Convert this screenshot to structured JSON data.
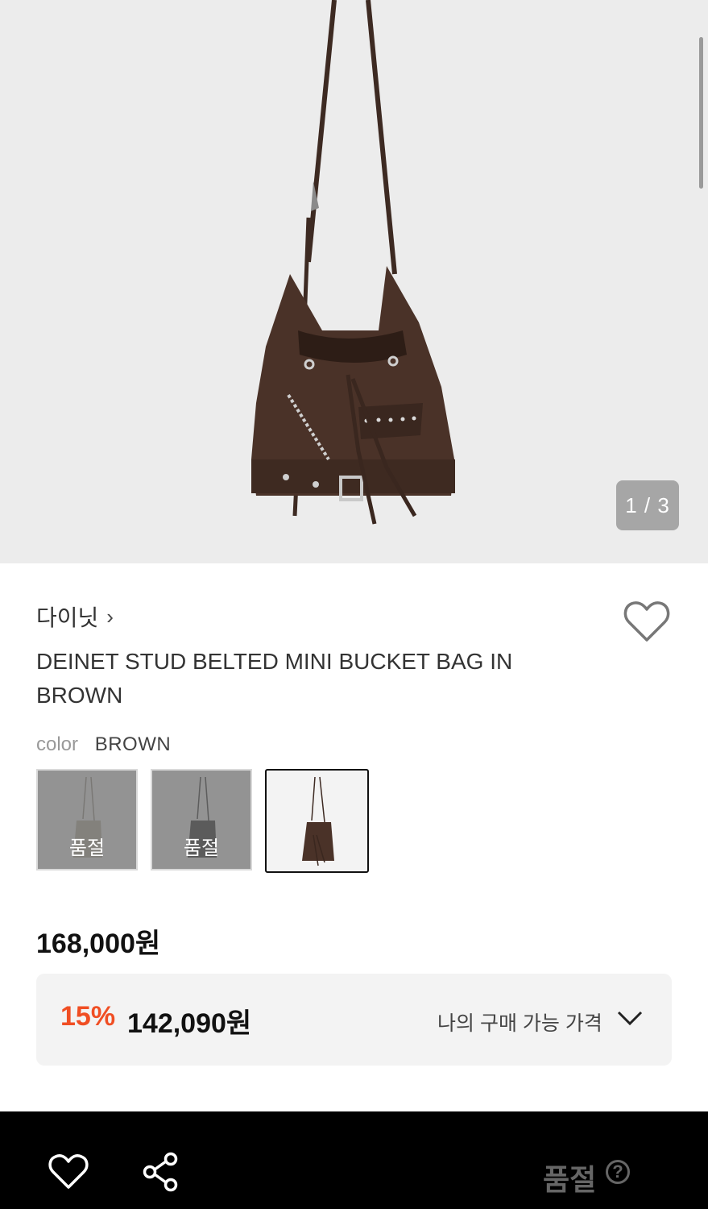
{
  "gallery": {
    "counter": "1 / 3",
    "current": 1,
    "total": 3
  },
  "product": {
    "brand": "다이닛",
    "brand_chevron": "›",
    "title": "DEINET STUD BELTED MINI BUCKET BAG IN BROWN",
    "color_label": "color",
    "color_value": "BROWN",
    "swatches": [
      {
        "name": "beige",
        "status": "품절",
        "sold_out": true,
        "bag_color": "#b9b3a3"
      },
      {
        "name": "black",
        "status": "품절",
        "sold_out": true,
        "bag_color": "#2e2e2e"
      },
      {
        "name": "brown",
        "status": "",
        "sold_out": false,
        "selected": true,
        "bag_color": "#4a3228"
      }
    ],
    "price": "168,000원"
  },
  "sale": {
    "discount": "15%",
    "price": "142,090원",
    "my_price_label": "나의 구매 가능 가격"
  },
  "bottom_bar": {
    "soldout_label": "품절",
    "help_glyph": "?"
  },
  "colors": {
    "accent": "#f04e23",
    "bag_brown": "#4a3228",
    "background_hero": "#ececec"
  }
}
